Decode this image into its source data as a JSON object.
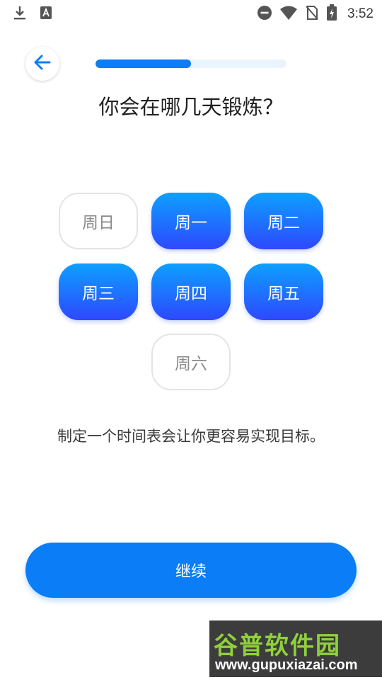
{
  "status_bar": {
    "time": "3:52",
    "icons": [
      "download-icon",
      "font-a-icon",
      "do-not-disturb-icon",
      "wifi-icon",
      "no-sim-icon",
      "battery-charging-icon"
    ]
  },
  "header": {
    "back_icon": "arrow-left-icon",
    "progress": 0.5
  },
  "title": "你会在哪几天锻炼？",
  "days": [
    {
      "label": "周日",
      "selected": false
    },
    {
      "label": "周一",
      "selected": true
    },
    {
      "label": "周二",
      "selected": true
    },
    {
      "label": "周三",
      "selected": true
    },
    {
      "label": "周四",
      "selected": true
    },
    {
      "label": "周五",
      "selected": true
    },
    {
      "label": "周六",
      "selected": false
    }
  ],
  "hint": "制定一个时间表会让你更容易实现目标。",
  "continue_label": "继续",
  "watermark": {
    "cn": "谷普软件园",
    "url": "www.gupuxiazai.com"
  },
  "colors": {
    "accent": "#0a7df7",
    "selected_top": "#0da0ff",
    "selected_bottom": "#2e48ff",
    "progress_track": "#eaf4ff"
  }
}
